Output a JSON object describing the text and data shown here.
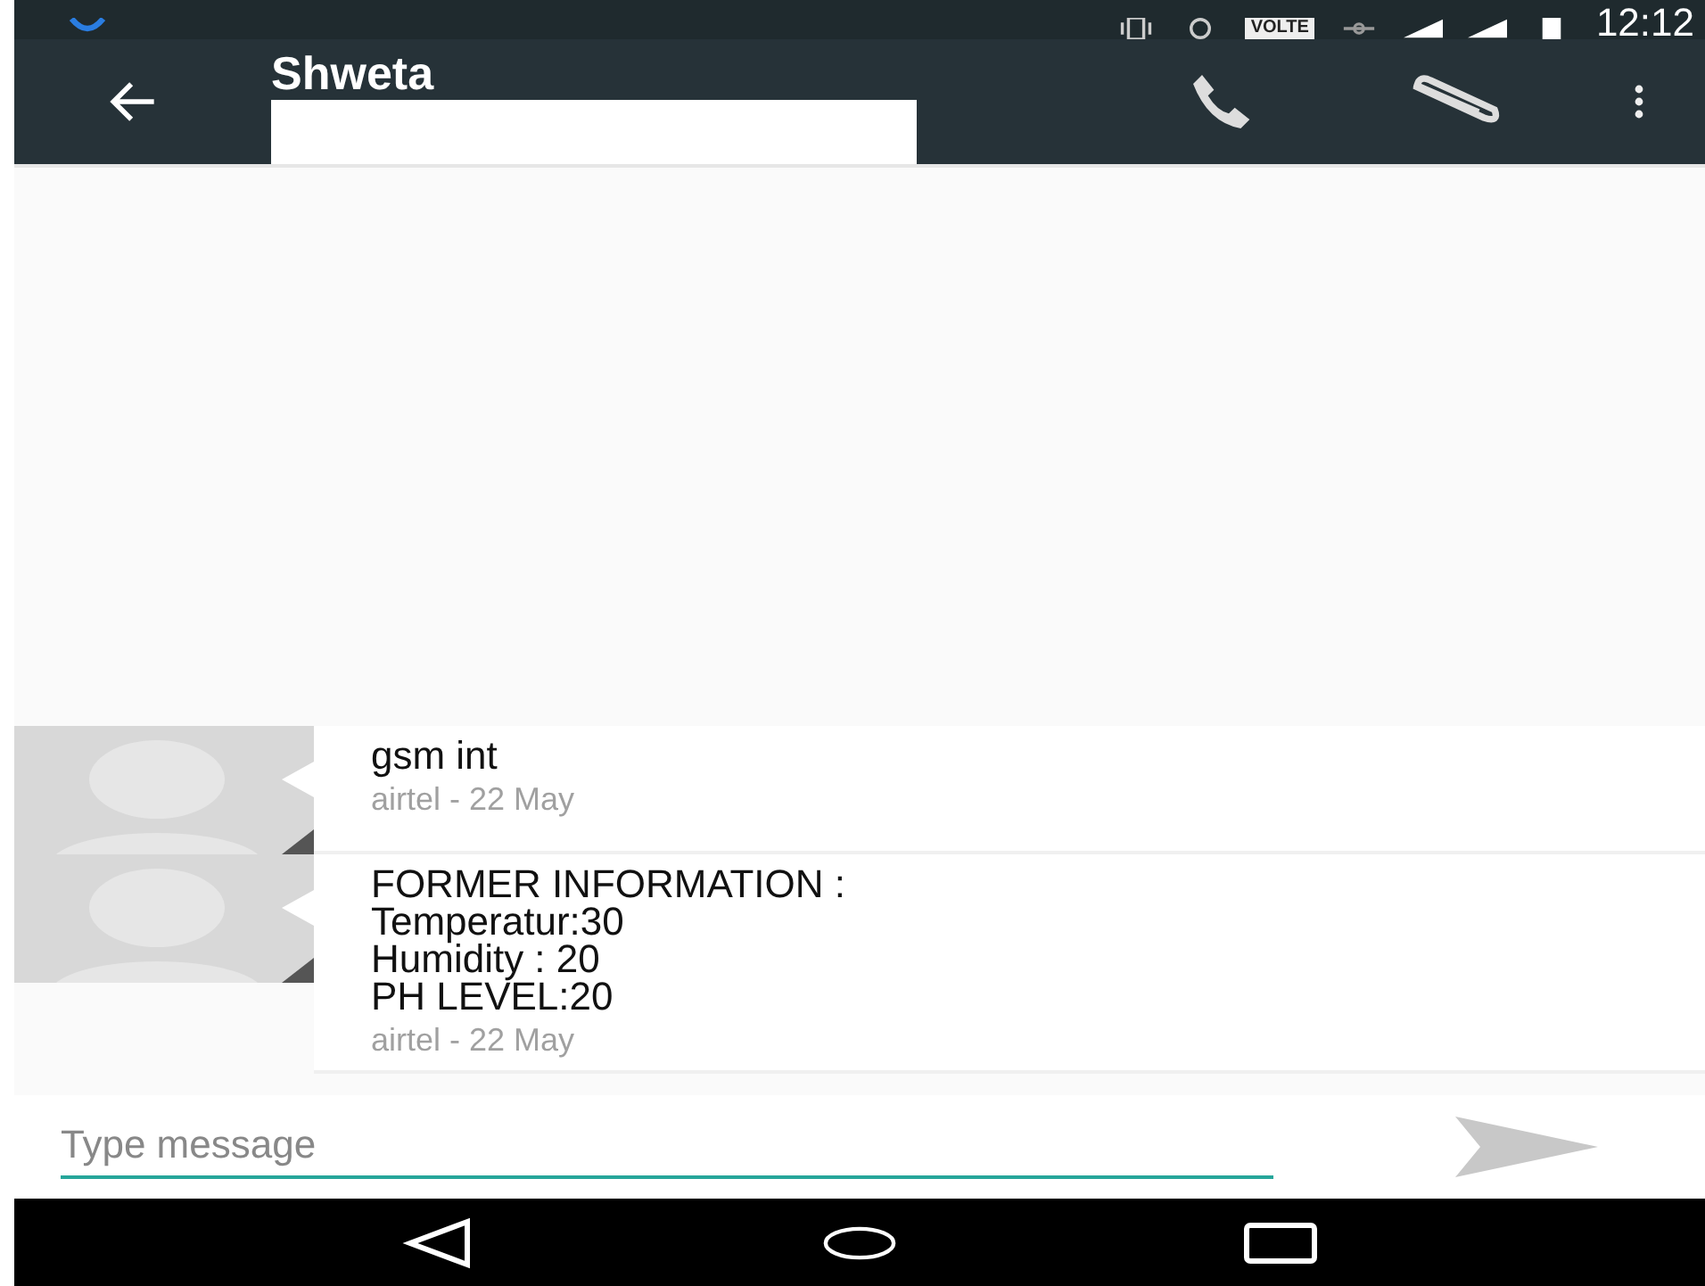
{
  "status_bar": {
    "network": "VOLTE",
    "time": "12:12"
  },
  "toolbar": {
    "title": "Shweta"
  },
  "messages": [
    {
      "lines": [
        "gsm int"
      ],
      "meta": "airtel - 22 May"
    },
    {
      "lines": [
        "FORMER INFORMATION :",
        "Temperatur:30",
        "Humidity : 20",
        "PH LEVEL:20"
      ],
      "meta": "airtel - 22 May"
    }
  ],
  "composer": {
    "placeholder": "Type message"
  }
}
